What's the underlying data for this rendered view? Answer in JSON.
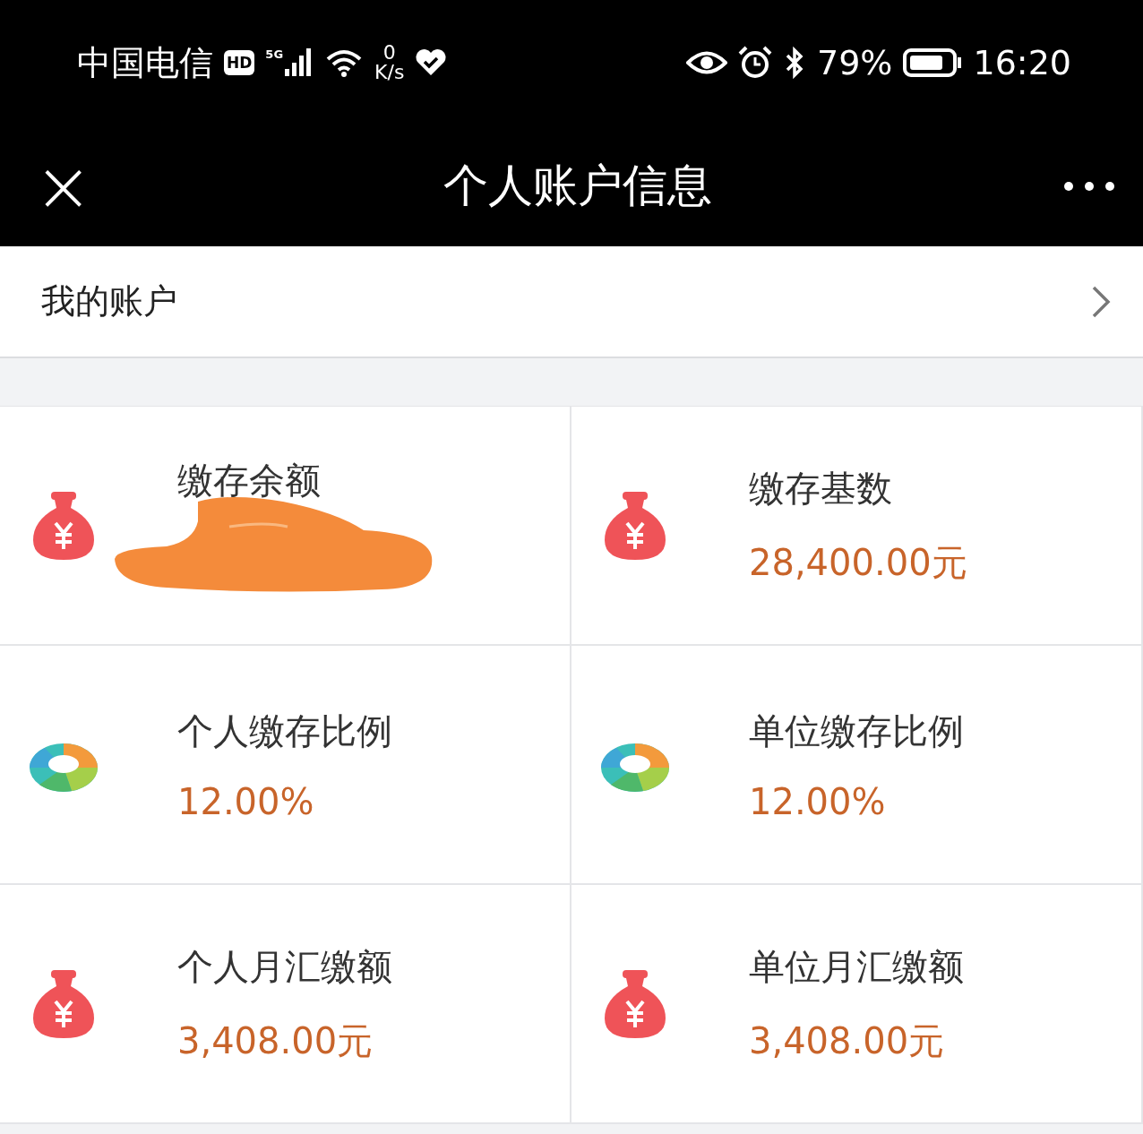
{
  "status_bar": {
    "carrier": "中国电信",
    "hd": "HD",
    "network": "5G",
    "speed_value": "0",
    "speed_unit": "K/s",
    "battery": "79%",
    "time": "16:20"
  },
  "header": {
    "close": "×",
    "title": "个人账户信息"
  },
  "account_row": {
    "label": "我的账户"
  },
  "cells": [
    {
      "kind": "money",
      "label": "缴存余额",
      "redacted": true
    },
    {
      "kind": "money",
      "label": "缴存基数",
      "value": "28,400.00元",
      "redacted": false
    },
    {
      "kind": "ratio",
      "label": "个人缴存比例",
      "value": "12.00%",
      "redacted": false
    },
    {
      "kind": "ratio",
      "label": "单位缴存比例",
      "value": "12.00%",
      "redacted": false
    },
    {
      "kind": "money",
      "label": "个人月汇缴额",
      "value": "3,408.00元",
      "redacted": false
    },
    {
      "kind": "money",
      "label": "单位月汇缴额",
      "value": "3,408.00元",
      "redacted": false
    }
  ]
}
